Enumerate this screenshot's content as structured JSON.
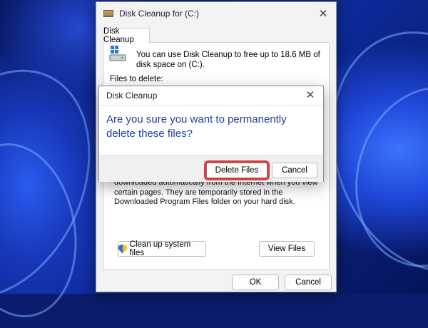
{
  "main_window": {
    "title": "Disk Cleanup for  (C:)",
    "tab_label": "Disk Cleanup",
    "summary_text": "You can use Disk Cleanup to free up to 18.6 MB of disk space on  (C:).",
    "files_to_delete_label": "Files to delete:",
    "description_text": "downloaded automatically from the Internet when you view certain pages. They are temporarily stored in the Downloaded Program Files folder on your hard disk.",
    "clean_system_button": "Clean up system files",
    "view_files_button": "View Files",
    "ok_button": "OK",
    "cancel_button": "Cancel",
    "close_glyph": "✕"
  },
  "confirm_dialog": {
    "title": "Disk Cleanup",
    "question": "Are you sure you want to permanently delete these files?",
    "delete_button": "Delete Files",
    "cancel_button": "Cancel",
    "close_glyph": "✕",
    "highlight_color": "#e0393e"
  },
  "icons": {
    "title_icon": "disk-cleanup-icon",
    "drive_icon": "windows-drive-icon",
    "shield_icon": "uac-shield-icon"
  }
}
